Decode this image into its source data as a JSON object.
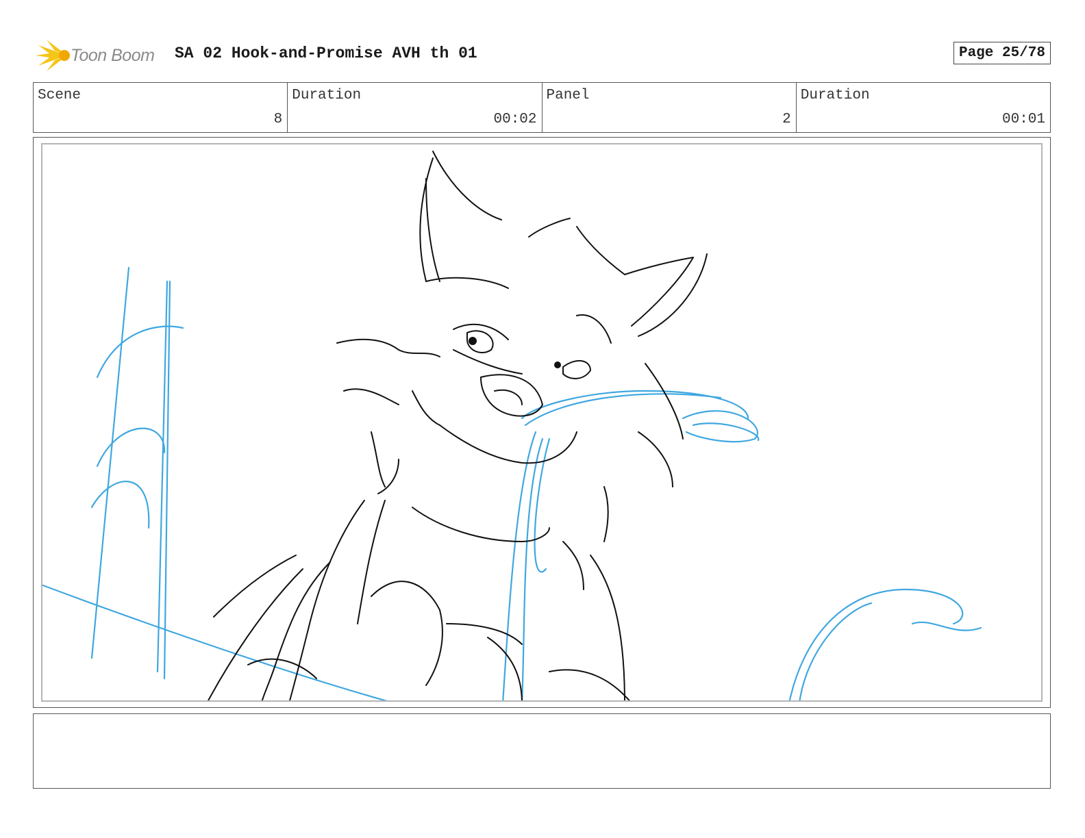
{
  "header": {
    "logo_text": "Toon Boom",
    "title": "SA 02 Hook-and-Promise AVH th 01",
    "page": "Page 25/78"
  },
  "info": [
    {
      "label": "Scene",
      "value": "8"
    },
    {
      "label": "Duration",
      "value": "00:02"
    },
    {
      "label": "Panel",
      "value": "2"
    },
    {
      "label": "Duration",
      "value": "00:01"
    }
  ],
  "panel": {
    "icon": "sketch-image",
    "ink_color": "#111111",
    "rough_color": "#3fa7e0"
  },
  "notes": {
    "text": ""
  },
  "colors": {
    "logo_star": "#f5c518",
    "frame": "#555555"
  }
}
